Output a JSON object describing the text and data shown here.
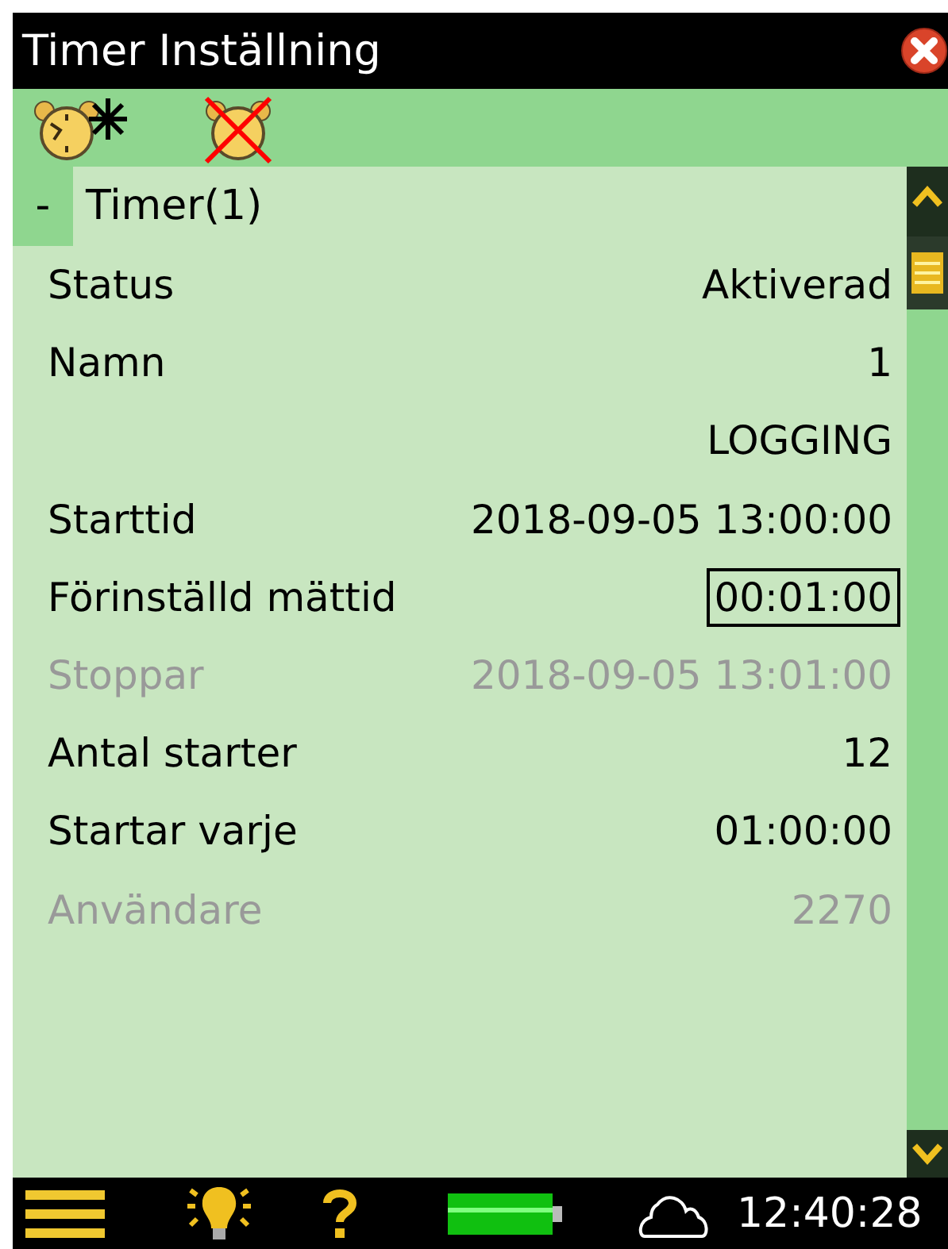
{
  "window": {
    "title": "Timer Inställning"
  },
  "tree": {
    "label": "Timer(1)",
    "toggle": "-"
  },
  "rows": [
    {
      "label": "Status",
      "value": "Aktiverad",
      "disabled": false,
      "selected": false
    },
    {
      "label": "Namn",
      "value": "1",
      "disabled": false,
      "selected": false
    },
    {
      "value": "LOGGING",
      "disabled": false,
      "selected": false
    },
    {
      "label": "Starttid",
      "value": "2018-09-05 13:00:00",
      "disabled": false,
      "selected": false
    },
    {
      "label": "Förinställd mättid",
      "value": "00:01:00",
      "disabled": false,
      "selected": true
    },
    {
      "label": "Stoppar",
      "value": "2018-09-05 13:01:00",
      "disabled": true,
      "selected": false
    },
    {
      "label": "Antal starter",
      "value": "12",
      "disabled": false,
      "selected": false
    },
    {
      "label": "Startar varje",
      "value": "01:00:00",
      "disabled": false,
      "selected": false
    },
    {
      "label": "Användare",
      "value": "2270",
      "disabled": true,
      "selected": false
    }
  ],
  "status_bar": {
    "time": "12:40:28"
  }
}
